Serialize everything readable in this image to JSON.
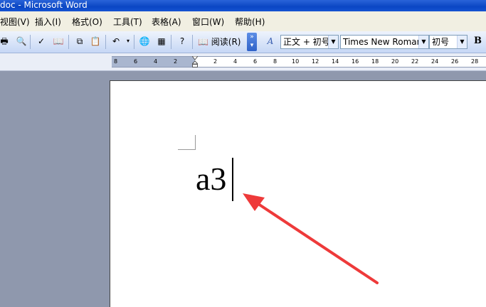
{
  "window": {
    "title": "doc - Microsoft Word"
  },
  "menu": {
    "items": [
      {
        "label": "视图(V)",
        "name": "menu-view"
      },
      {
        "label": "插入(I)",
        "name": "menu-insert"
      },
      {
        "label": "格式(O)",
        "name": "menu-format"
      },
      {
        "label": "工具(T)",
        "name": "menu-tools"
      },
      {
        "label": "表格(A)",
        "name": "menu-table"
      },
      {
        "label": "窗口(W)",
        "name": "menu-window"
      },
      {
        "label": "帮助(H)",
        "name": "menu-help"
      }
    ]
  },
  "toolbar": {
    "reading_label": "阅读(R)",
    "style_value": "正文 + 初号",
    "font_value": "Times New Roman",
    "size_value": "初号",
    "bold_label": "B"
  },
  "ruler": {
    "labels": [
      "8",
      "6",
      "4",
      "2",
      "2",
      "4",
      "6",
      "8",
      "10",
      "12",
      "14",
      "16",
      "18",
      "20",
      "22",
      "24",
      "26",
      "28"
    ]
  },
  "document": {
    "text": "a3"
  },
  "annotation": {
    "color": "#ee3a3a"
  }
}
